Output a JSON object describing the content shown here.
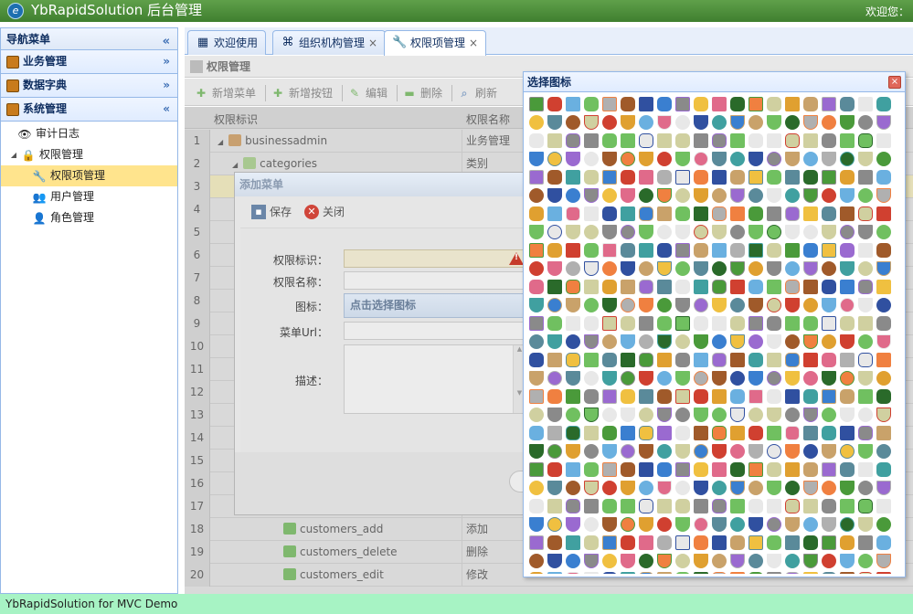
{
  "app": {
    "title": "YbRapidSolution 后台管理",
    "welcome": "欢迎您：",
    "logo_letter": "e",
    "footer": "YbRapidSolution for MVC Demo"
  },
  "nav": {
    "header": "导航菜单",
    "collapse_icon": "double-chevron-left-icon",
    "sections": [
      {
        "label": "业务管理",
        "icon": "briefcase-icon",
        "chevron": "»"
      },
      {
        "label": "数据字典",
        "icon": "book-icon",
        "chevron": "»"
      },
      {
        "label": "系统管理",
        "icon": "cabinet-icon",
        "chevron": "«"
      }
    ],
    "tree": [
      {
        "label": "审计日志",
        "icon": "eye-icon",
        "glyph": "👁",
        "level": 1,
        "selected": false
      },
      {
        "label": "权限管理",
        "icon": "lock-icon",
        "glyph": "🔒",
        "level": 0,
        "expander": "◢",
        "selected": false
      },
      {
        "label": "权限项管理",
        "icon": "wrench-icon",
        "glyph": "🔧",
        "level": 2,
        "selected": true
      },
      {
        "label": "用户管理",
        "icon": "users-icon",
        "glyph": "👥",
        "level": 2,
        "selected": false
      },
      {
        "label": "角色管理",
        "icon": "user-icon",
        "glyph": "👤",
        "level": 2,
        "selected": false
      }
    ]
  },
  "tabs": [
    {
      "label": "欢迎使用",
      "icon": "layout-icon",
      "glyph": "▦",
      "closable": false,
      "active": false
    },
    {
      "label": "组织机构管理",
      "icon": "org-chart-icon",
      "glyph": "⌘",
      "closable": true,
      "active": false
    },
    {
      "label": "权限项管理",
      "icon": "wrench-icon",
      "glyph": "🔧",
      "closable": true,
      "active": true
    }
  ],
  "tab_close": "×",
  "panel": {
    "title": "权限管理",
    "icon": "table-icon"
  },
  "toolbar": [
    {
      "label": "新增菜单",
      "icon": "add-icon",
      "glyph": "✚",
      "color": "#7fb86e"
    },
    {
      "label": "新增按钮",
      "icon": "add-icon",
      "glyph": "✚",
      "color": "#7fb86e"
    },
    {
      "label": "编辑",
      "icon": "pencil-icon",
      "glyph": "✎",
      "color": "#7fb86e"
    },
    {
      "label": "删除",
      "icon": "delete-icon",
      "glyph": "▬",
      "color": "#7fb86e"
    },
    {
      "label": "刷新",
      "icon": "search-icon",
      "glyph": "⌕",
      "color": "#8fa8c8"
    }
  ],
  "grid": {
    "headers": {
      "code": "权限标识",
      "name": "权限名称"
    },
    "rows": [
      {
        "n": "1",
        "code": "businessadmin",
        "name": "业务管理",
        "indent": 0,
        "expander": "◢",
        "icon": "cabinet-icon",
        "color": "#c8a070"
      },
      {
        "n": "2",
        "code": "categories",
        "name": "类别",
        "indent": 1,
        "expander": "◢",
        "icon": "table-icon",
        "color": "#a8c890"
      },
      {
        "n": "3",
        "code": "",
        "name": "",
        "indent": 0,
        "expander": "",
        "icon": "",
        "color": "",
        "highlight": true
      },
      {
        "n": "4",
        "code": "",
        "name": "",
        "indent": 0,
        "expander": "",
        "icon": "",
        "color": ""
      },
      {
        "n": "5",
        "code": "",
        "name": "",
        "indent": 0,
        "expander": "",
        "icon": "",
        "color": ""
      },
      {
        "n": "6",
        "code": "",
        "name": "",
        "indent": 0,
        "expander": "",
        "icon": "",
        "color": ""
      },
      {
        "n": "7",
        "code": "",
        "name": "",
        "indent": 0,
        "expander": "",
        "icon": "",
        "color": ""
      },
      {
        "n": "8",
        "code": "",
        "name": "",
        "indent": 0,
        "expander": "",
        "icon": "",
        "color": ""
      },
      {
        "n": "9",
        "code": "",
        "name": "",
        "indent": 0,
        "expander": "",
        "icon": "",
        "color": ""
      },
      {
        "n": "10",
        "code": "",
        "name": "",
        "indent": 0,
        "expander": "",
        "icon": "",
        "color": ""
      },
      {
        "n": "11",
        "code": "",
        "name": "",
        "indent": 0,
        "expander": "",
        "icon": "",
        "color": ""
      },
      {
        "n": "12",
        "code": "",
        "name": "",
        "indent": 0,
        "expander": "",
        "icon": "",
        "color": ""
      },
      {
        "n": "13",
        "code": "",
        "name": "",
        "indent": 0,
        "expander": "",
        "icon": "",
        "color": ""
      },
      {
        "n": "14",
        "code": "",
        "name": "",
        "indent": 0,
        "expander": "",
        "icon": "",
        "color": ""
      },
      {
        "n": "15",
        "code": "",
        "name": "",
        "indent": 0,
        "expander": "",
        "icon": "",
        "color": ""
      },
      {
        "n": "16",
        "code": "",
        "name": "",
        "indent": 0,
        "expander": "",
        "icon": "",
        "color": ""
      },
      {
        "n": "17",
        "code": "",
        "name": "",
        "indent": 0,
        "expander": "",
        "icon": "",
        "color": ""
      },
      {
        "n": "18",
        "code": "customers_add",
        "name": "添加",
        "indent": 2,
        "expander": "",
        "icon": "add-icon",
        "color": "#7fb86e"
      },
      {
        "n": "19",
        "code": "customers_delete",
        "name": "删除",
        "indent": 2,
        "expander": "",
        "icon": "delete-icon",
        "color": "#7fb86e"
      },
      {
        "n": "20",
        "code": "customers_edit",
        "name": "修改",
        "indent": 2,
        "expander": "",
        "icon": "pencil-icon",
        "color": "#7fb86e"
      }
    ]
  },
  "dialog": {
    "title": "添加菜单",
    "save": "保存",
    "close": "关闭",
    "fields": {
      "code": "权限标识：",
      "name": "权限名称：",
      "icon": "图标：",
      "url": "菜单Url：",
      "desc": "描述："
    },
    "icon_placeholder": "点击选择图标"
  },
  "picker": {
    "title": "选择图标",
    "close_glyph": "×",
    "palette": [
      "#4a9a3a",
      "#3a7fd0",
      "#e0a030",
      "#d04030",
      "#8a8a8a",
      "#c9a26a",
      "#6ab0e0",
      "#f0c040",
      "#9a6ad0",
      "#70c060",
      "#e06a8a",
      "#5a8a9a",
      "#b0b0b0",
      "#2a6a2a",
      "#e8e8e8",
      "#a05a2a",
      "#f08040",
      "#40a0a0",
      "#3050a0",
      "#d0d0a0"
    ],
    "shapes": [
      "s-sq",
      "s-ci",
      "s-rd",
      "s-tr"
    ],
    "rows": 27,
    "cols": 20
  }
}
